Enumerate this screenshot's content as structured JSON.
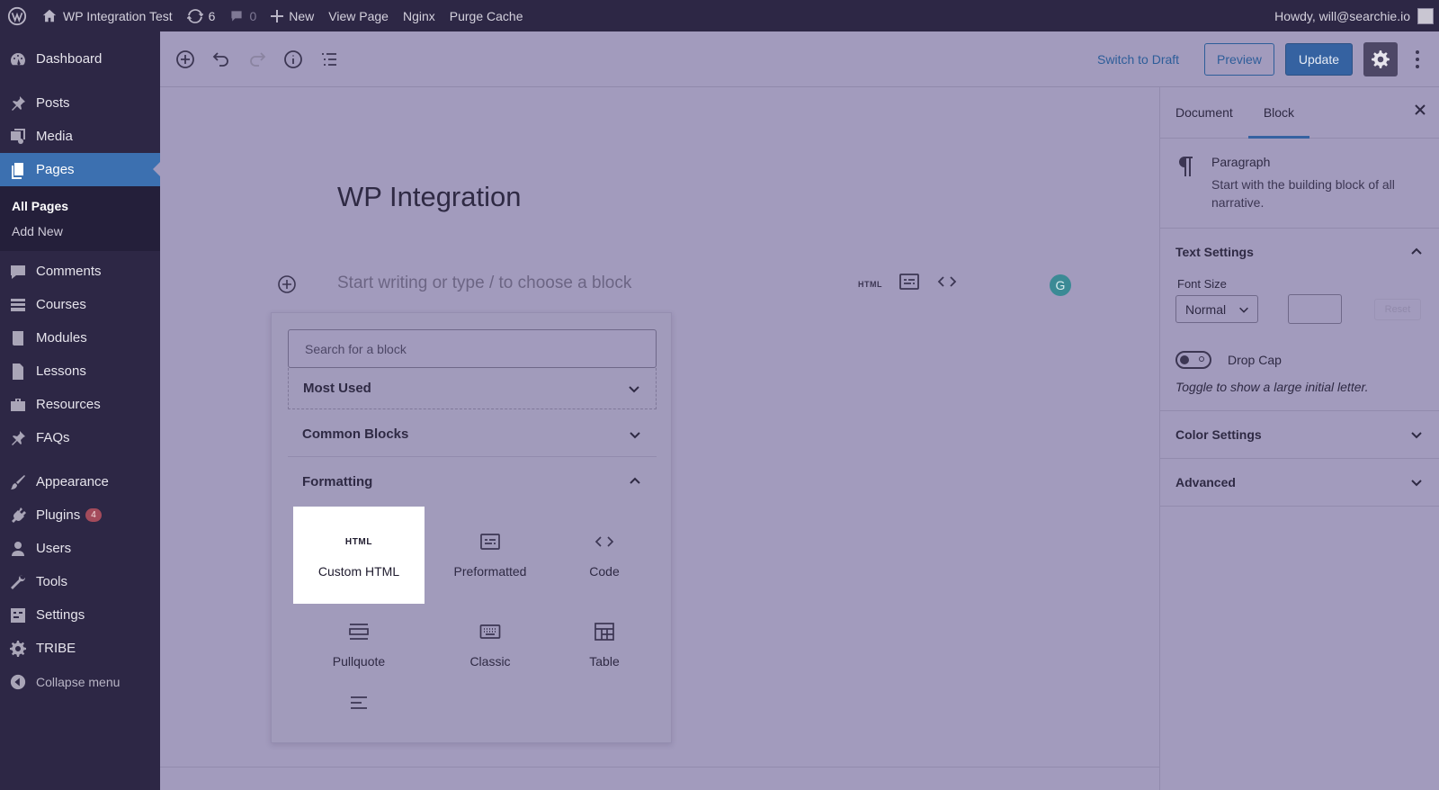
{
  "admin_bar": {
    "site_name": "WP Integration Test",
    "updates_count": "6",
    "comments_count": "0",
    "new_label": "New",
    "view_page": "View Page",
    "nginx": "Nginx",
    "purge_cache": "Purge Cache",
    "howdy": "Howdy, will@searchie.io"
  },
  "menu": {
    "dashboard": "Dashboard",
    "posts": "Posts",
    "media": "Media",
    "pages": "Pages",
    "all_pages": "All Pages",
    "add_new": "Add New",
    "comments": "Comments",
    "courses": "Courses",
    "modules": "Modules",
    "lessons": "Lessons",
    "resources": "Resources",
    "faqs": "FAQs",
    "appearance": "Appearance",
    "plugins": "Plugins",
    "plugins_badge": "4",
    "users": "Users",
    "tools": "Tools",
    "settings": "Settings",
    "tribe": "TRIBE",
    "collapse": "Collapse menu"
  },
  "header": {
    "switch_to_draft": "Switch to Draft",
    "preview": "Preview",
    "update": "Update"
  },
  "editor": {
    "title": "WP Integration",
    "placeholder": "Start writing or type / to choose a block",
    "html_tool": "HTML",
    "grammarly": "G"
  },
  "inserter": {
    "search_placeholder": "Search for a block",
    "most_used": "Most Used",
    "common_blocks": "Common Blocks",
    "formatting": "Formatting",
    "html_icon_text": "HTML",
    "blocks": {
      "custom_html": "Custom HTML",
      "preformatted": "Preformatted",
      "code": "Code",
      "pullquote": "Pullquote",
      "classic": "Classic",
      "table": "Table"
    }
  },
  "sidebar": {
    "tab_document": "Document",
    "tab_block": "Block",
    "block_name": "Paragraph",
    "block_desc": "Start with the building block of all narrative.",
    "text_settings": "Text Settings",
    "font_size_label": "Font Size",
    "font_size_value": "Normal",
    "reset": "Reset",
    "drop_cap": "Drop Cap",
    "drop_cap_help": "Toggle to show a large initial letter.",
    "color_settings": "Color Settings",
    "advanced": "Advanced"
  }
}
